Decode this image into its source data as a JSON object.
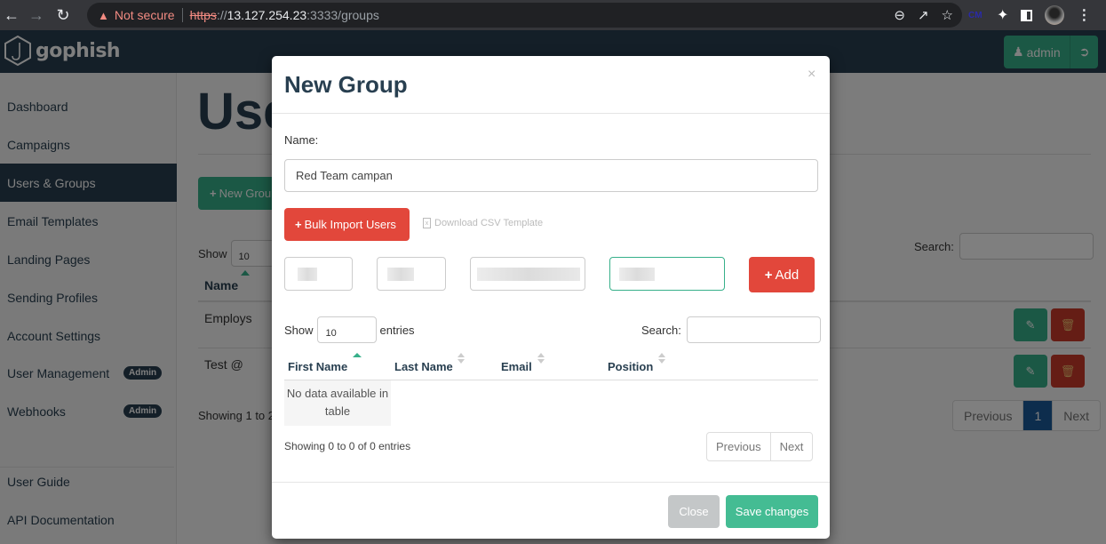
{
  "browser": {
    "security_label": "Not secure",
    "url_scheme": "https",
    "url_slashes": "://",
    "url_host": "13.127.254.23",
    "url_rest": ":3333/groups",
    "icons": [
      "back-icon",
      "forward-icon",
      "reload-icon",
      "zoom-out-icon",
      "share-icon",
      "star-icon",
      "extension-cm-icon",
      "puzzle-icon",
      "side-panel-icon",
      "profile-avatar",
      "kebab-menu-icon"
    ],
    "ext_label": "CM"
  },
  "app": {
    "brand": "gophish",
    "user_label": "admin",
    "logout_icon": "sign-out-icon"
  },
  "sidebar": {
    "items": [
      {
        "label": "Dashboard"
      },
      {
        "label": "Campaigns"
      },
      {
        "label": "Users & Groups",
        "active": true
      },
      {
        "label": "Email Templates"
      },
      {
        "label": "Landing Pages"
      },
      {
        "label": "Sending Profiles"
      },
      {
        "label": "Account Settings"
      },
      {
        "label": "User Management",
        "badge": "Admin"
      },
      {
        "label": "Webhooks",
        "badge": "Admin"
      }
    ],
    "footer": [
      {
        "label": "User Guide"
      },
      {
        "label": "API Documentation"
      }
    ]
  },
  "main": {
    "title": "Users & Groups",
    "new_group_label": "New Group",
    "show_label": "Show",
    "show_value": "10",
    "search_label": "Search:",
    "column_name": "Name",
    "rows": [
      {
        "name": "Employs"
      },
      {
        "name": "Test @"
      }
    ],
    "showing_text": "Showing 1 to 2",
    "pager": {
      "previous": "Previous",
      "current": "1",
      "next": "Next"
    }
  },
  "modal": {
    "title": "New Group",
    "close_glyph": "×",
    "name_label": "Name:",
    "name_value": "Red Team campan",
    "bulk_import_label": "Bulk Import Users",
    "download_csv_label": "Download CSV Template",
    "add_label": "Add",
    "show_label": "Show",
    "show_value": "10",
    "entries_label": "entries",
    "search_label": "Search:",
    "columns": [
      "First Name",
      "Last Name",
      "Email",
      "Position"
    ],
    "empty_text": "No data available in table",
    "showing_text": "Showing 0 to 0 of 0 entries",
    "pager": {
      "previous": "Previous",
      "next": "Next"
    },
    "close_label": "Close",
    "save_label": "Save changes"
  },
  "colors": {
    "brand_dark": "#283f50",
    "accent_green": "#37b08a",
    "danger_red": "#e2473b",
    "page_active_blue": "#1a5a9a"
  }
}
